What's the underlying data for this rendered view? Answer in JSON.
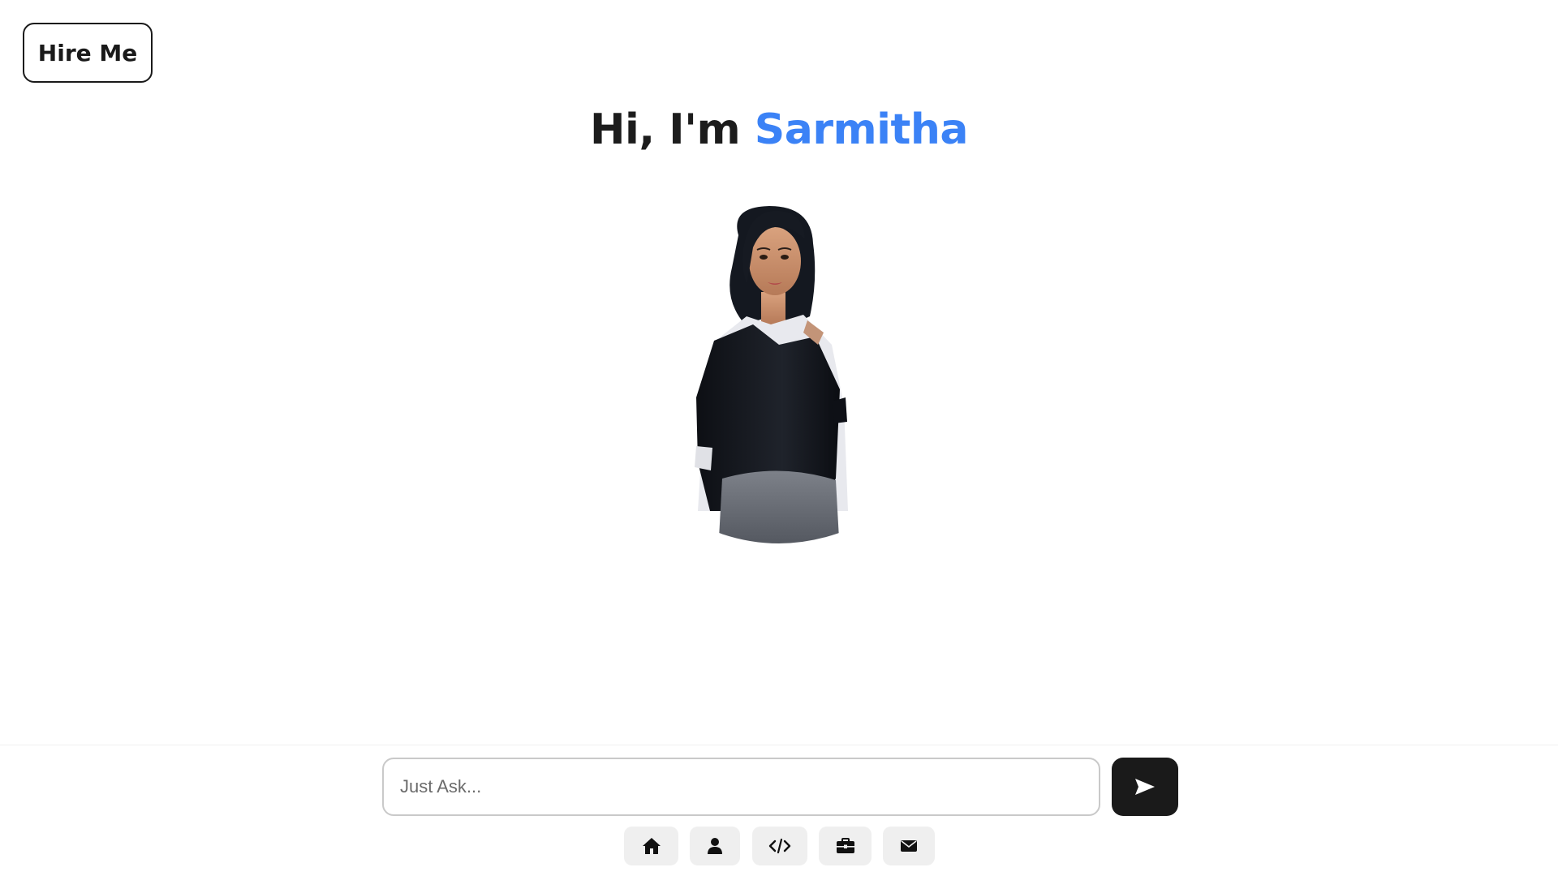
{
  "header": {
    "hire_label": "Hire Me"
  },
  "hero": {
    "greeting": "Hi, I'm",
    "name": "Sarmitha",
    "accent_color": "#3b82f6"
  },
  "chat": {
    "placeholder": "Just Ask...",
    "value": "",
    "send_icon": "send-arrow-icon"
  },
  "nav": {
    "items": [
      {
        "icon": "home-icon"
      },
      {
        "icon": "user-icon"
      },
      {
        "icon": "code-icon"
      },
      {
        "icon": "briefcase-icon"
      },
      {
        "icon": "mail-icon"
      }
    ]
  }
}
